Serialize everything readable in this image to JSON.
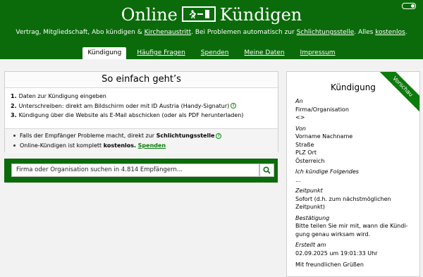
{
  "header": {
    "logo_left": "Online",
    "logo_right": "Kündigen",
    "tagline": {
      "t1": "Vertrag, Mitgliedschaft, Abo kündigen & ",
      "l1": "Kirchenaustritt",
      "t2": ". Bei Problemen automatisch zur ",
      "l2": "Schlichtungsstelle",
      "t3": ". Alles ",
      "l3": "kostenlos",
      "t4": "."
    }
  },
  "nav": {
    "kuendigung": "Kündigung",
    "faq": "Häufige Fragen",
    "spenden": "Spenden",
    "meine_daten": "Meine Daten",
    "impressum": "Impressum"
  },
  "how": {
    "title": "So einfach geht’s",
    "steps": [
      {
        "num": "1.",
        "text": "Daten zur Kündigung eingeben"
      },
      {
        "num": "2.",
        "text": "Unterschreiben: direkt am Bildschirm oder mit ID Austria (Handy-Signatur)"
      },
      {
        "num": "3.",
        "text": "Kündigung über die Website als E-Mail abschicken (oder als PDF herunterladen)"
      }
    ],
    "note1_text": "Falls der Empfänger Probleme macht, direkt zur ",
    "note1_bold": "Schlichtungsstelle",
    "note2_text": "Online-Kündigen ist komplett ",
    "note2_bold": "kostenlos.",
    "note2_link": "Spenden"
  },
  "search": {
    "placeholder": "Firma oder Organisation suchen in 4.814 Empfängern..."
  },
  "preview": {
    "ribbon": "Vorschau",
    "title": "Kündigung",
    "an_label": "An",
    "an_lines": [
      "Firma/Organisation",
      "<>"
    ],
    "von_label": "Von",
    "von_lines": [
      "Vorname Nachname",
      "Straße",
      "PLZ Ort",
      "Österreich"
    ],
    "folgendes_label": "Ich kündige Folgendes",
    "folgendes_value": "...",
    "zeitpunkt_label": "Zeitpunkt",
    "zeitpunkt_lines": [
      "Sofort (d.h. zum nächstmöglichen",
      "Zeitpunkt)"
    ],
    "bestaetigung_label": "Bestätigung",
    "bestaetigung_lines": [
      "Bitte teilen Sie mir mit, wann die Kündi-",
      "gung genau wirksam wird."
    ],
    "erstellt_label": "Erstellt am",
    "erstellt_value": "02.09.2025 um 19:01:33 Uhr",
    "gruesse": "Mit freundlichen Grüßen"
  },
  "colors": {
    "brand_green": "#0b6b0b",
    "link_green": "#0b7b0b"
  }
}
